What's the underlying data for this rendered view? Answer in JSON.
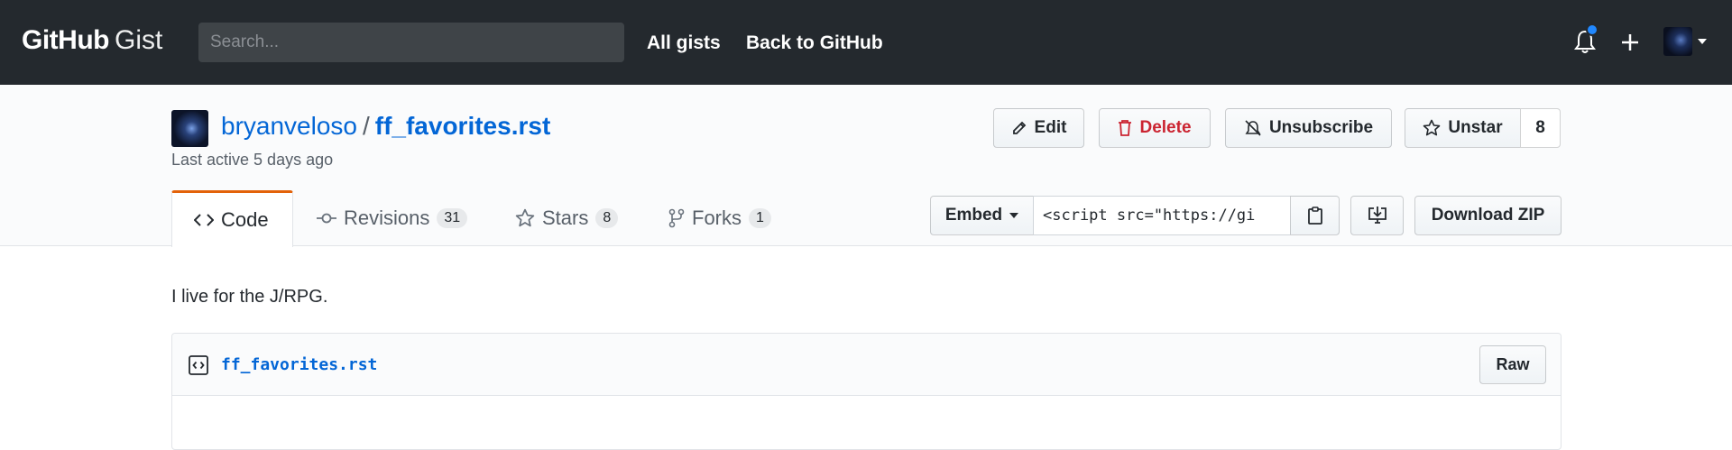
{
  "nav": {
    "logo_github": "GitHub",
    "logo_gist": "Gist",
    "search_placeholder": "Search...",
    "all_gists": "All gists",
    "back_to_github": "Back to GitHub"
  },
  "gist": {
    "owner": "bryanveloso",
    "separator": "/",
    "filename": "ff_favorites.rst",
    "last_active": "Last active 5 days ago",
    "description": "I live for the J/RPG."
  },
  "actions": {
    "edit": "Edit",
    "delete": "Delete",
    "unsubscribe": "Unsubscribe",
    "unstar": "Unstar",
    "star_count": "8"
  },
  "tabs": {
    "code": "Code",
    "revisions": "Revisions",
    "revisions_count": "31",
    "stars": "Stars",
    "stars_count": "8",
    "forks": "Forks",
    "forks_count": "1"
  },
  "embed": {
    "label": "Embed",
    "value": "<script src=\"https://gi",
    "download_zip": "Download ZIP"
  },
  "file": {
    "name": "ff_favorites.rst",
    "raw": "Raw"
  },
  "colors": {
    "nav_bg": "#24292e",
    "link": "#0366d6",
    "delete": "#cb2431",
    "tab_accent": "#e36209",
    "notification": "#2188ff"
  }
}
